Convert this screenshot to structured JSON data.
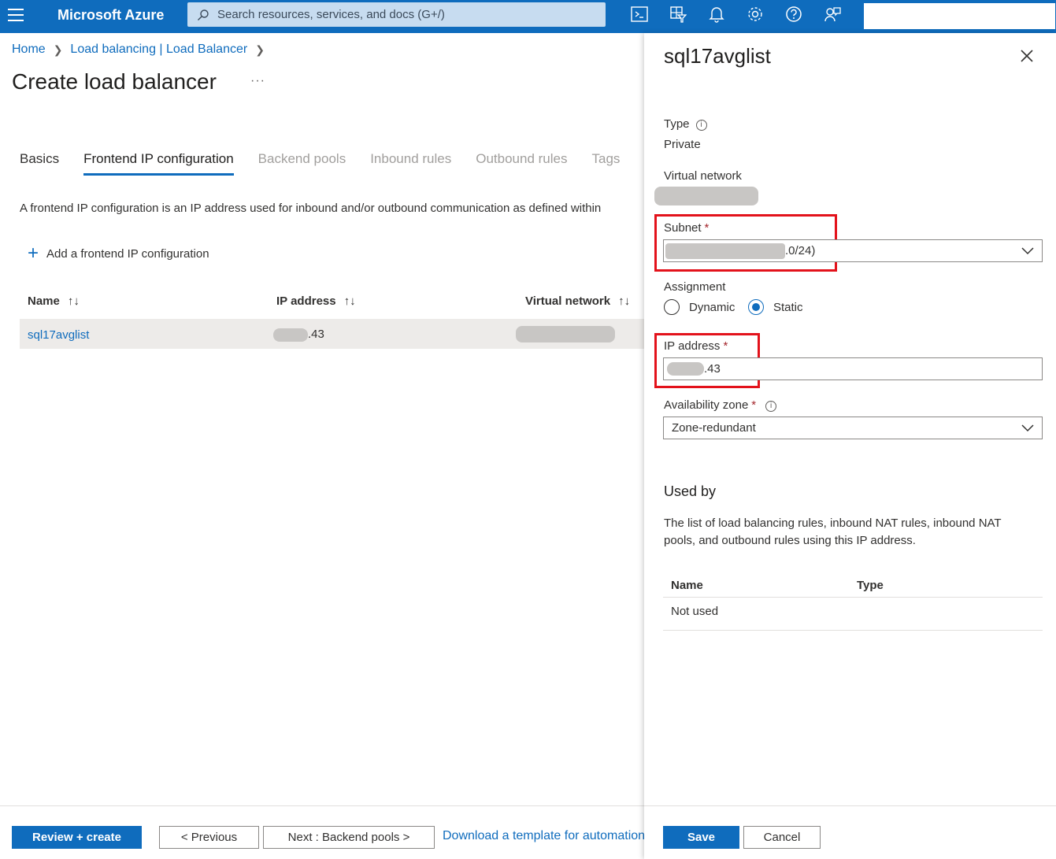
{
  "topbar": {
    "brand": "Microsoft Azure",
    "search_placeholder": "Search resources, services, and docs (G+/)",
    "icons": [
      "cloud-shell-icon",
      "directory-filter-icon",
      "bell-icon",
      "gear-icon",
      "help-icon",
      "feedback-icon"
    ]
  },
  "breadcrumb": {
    "items": [
      "Home",
      "Load balancing | Load Balancer"
    ]
  },
  "page": {
    "title": "Create load balancer",
    "more": "···"
  },
  "tabs": [
    "Basics",
    "Frontend IP configuration",
    "Backend pools",
    "Inbound rules",
    "Outbound rules",
    "Tags"
  ],
  "main": {
    "description": "A frontend IP configuration is an IP address used for inbound and/or outbound communication as defined within",
    "add_label": "Add a frontend IP configuration",
    "columns": [
      "Name",
      "IP address",
      "Virtual network"
    ],
    "sort_glyph": "↑↓",
    "rows": [
      {
        "name": "sql17avglist",
        "ip_suffix": ".43"
      }
    ]
  },
  "footer": {
    "review_create": "Review + create",
    "previous": "< Previous",
    "next": "Next : Backend pools >",
    "download_link": "Download a template for automation"
  },
  "panel": {
    "title": "sql17avglist",
    "type_label": "Type",
    "type_value": "Private",
    "vnet_label": "Virtual network",
    "subnet_label": "Subnet",
    "subnet_suffix": ".0/24)",
    "assignment_label": "Assignment",
    "assignment_options": [
      "Dynamic",
      "Static"
    ],
    "assignment_selected": "Static",
    "ip_label": "IP address",
    "ip_suffix": ".43",
    "zone_label": "Availability zone",
    "zone_value": "Zone-redundant",
    "required_mark": "*",
    "usedby_title": "Used by",
    "usedby_desc": "The list of load balancing rules, inbound NAT rules, inbound NAT pools, and outbound rules using this IP address.",
    "usedby_columns": [
      "Name",
      "Type"
    ],
    "usedby_empty": "Not used",
    "save": "Save",
    "cancel": "Cancel"
  },
  "colors": {
    "accent": "#0f6cbd",
    "highlight": "#e3121b"
  }
}
